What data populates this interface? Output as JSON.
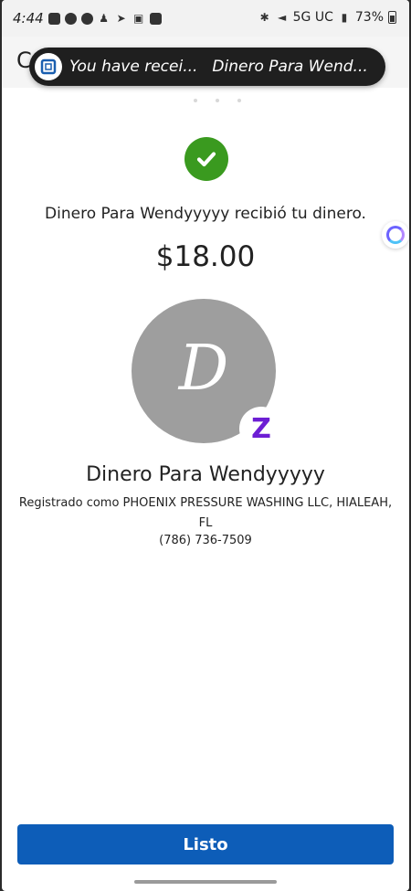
{
  "status_bar": {
    "time": "4:44",
    "network": "5G UC",
    "battery": "73%"
  },
  "header": {
    "partial_title": "C"
  },
  "notification": {
    "title": "You have recei...",
    "subtitle": "Dinero Para Wend..."
  },
  "confirmation": {
    "message": "Dinero Para Wendyyyyy recibió tu dinero.",
    "amount": "$18.00"
  },
  "recipient": {
    "initial": "D",
    "badge_letter": "Z",
    "name": "Dinero Para Wendyyyyy",
    "registered": "Registrado como PHOENIX PRESSURE WASHING LLC, HIALEAH, FL",
    "phone": "(786) 736-7509"
  },
  "actions": {
    "done_label": "Listo"
  },
  "colors": {
    "accent": "#0d5db8",
    "success": "#3a9a1f",
    "zelle": "#6d1ed4",
    "avatar_bg": "#9e9e9e"
  }
}
